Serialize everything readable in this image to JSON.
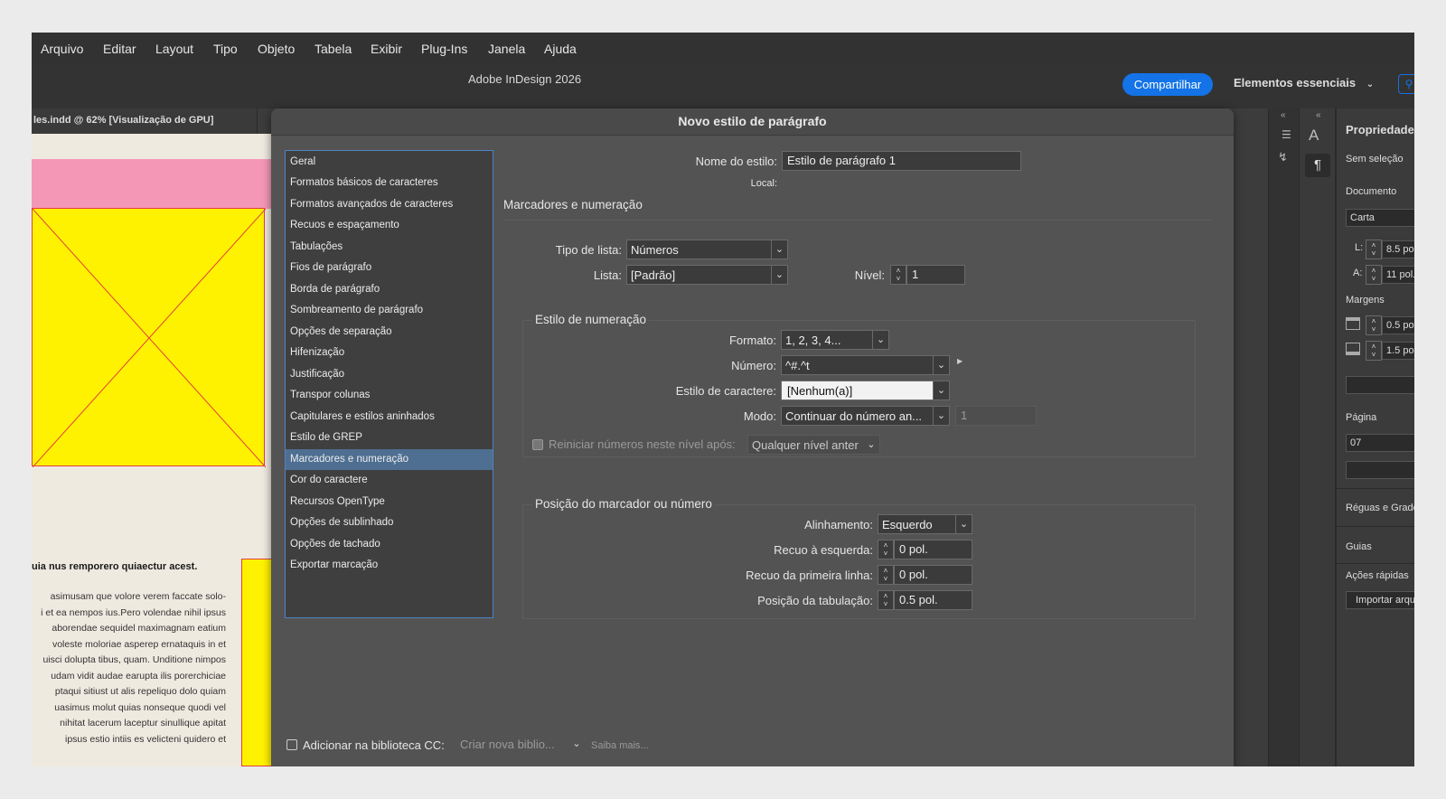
{
  "menubar": {
    "items": [
      "Arquivo",
      "Editar",
      "Layout",
      "Tipo",
      "Objeto",
      "Tabela",
      "Exibir",
      "Plug-Ins",
      "Janela",
      "Ajuda"
    ]
  },
  "titlebar": {
    "app_title": "Adobe InDesign 2026",
    "share_label": "Compartilhar",
    "workspace_label": "Elementos essenciais",
    "workspace_icon": "chevron-down-icon",
    "search_icon": "search-icon"
  },
  "document": {
    "tab_label": "les.indd @ 62% [Visualização de GPU]",
    "headline": "uia nus remporero quiaectur acest.",
    "body_lines": [
      "asimusam que volore verem faccate solo-",
      "i et ea nempos ius.Pero volendae nihil ipsus",
      "aborendae sequidel maximagnam eatium",
      "voleste moloriae asperep ernataquis in et",
      "uisci dolupta tibus, quam. Unditione nimpos",
      "udam vidit audae earupta ilis porerchiciae",
      "ptaqui sitiust ut alis repeliquo dolo quiam",
      "uasimus molut quias nonseque quodi vel",
      "nihitat lacerum laceptur sinullique apitat",
      " ipsus estio intiis es velicteni quidero et"
    ]
  },
  "properties": {
    "title": "Propriedades",
    "no_selection": "Sem seleção",
    "document_label": "Documento",
    "preset": "Carta",
    "width_label": "L:",
    "width": "8.5 pol.",
    "height_label": "A:",
    "height": "11 pol.",
    "margins_label": "Margens",
    "margin_top": "0.5 pol.",
    "margin_bottom": "1.5 pol.",
    "page_label": "Página",
    "page": "07",
    "rulers_label": "Réguas e Grades",
    "guides_label": "Guias",
    "quick_actions_label": "Ações rápidas",
    "import_label": "Importar arqu"
  },
  "dialog": {
    "title": "Novo estilo de parágrafo",
    "categories": [
      "Geral",
      "Formatos básicos de caracteres",
      "Formatos avançados de caracteres",
      "Recuos e espaçamento",
      "Tabulações",
      "Fios de parágrafo",
      "Borda de parágrafo",
      "Sombreamento de parágrafo",
      "Opções de separação",
      "Hifenização",
      "Justificação",
      "Transpor colunas",
      "Capitulares e estilos aninhados",
      "Estilo de GREP",
      "Marcadores e numeração",
      "Cor do caractere",
      "Recursos OpenType",
      "Opções de sublinhado",
      "Opções de tachado",
      "Exportar marcação"
    ],
    "selected_category": "Marcadores e numeração",
    "style_name_label": "Nome do estilo:",
    "style_name": "Estilo de parágrafo 1",
    "local_label": "Local:",
    "section_title": "Marcadores e numeração",
    "list_type_label": "Tipo de lista:",
    "list_type": "Números",
    "list_label": "Lista:",
    "list": "[Padrão]",
    "level_label": "Nível:",
    "level": "1",
    "numbering_group": "Estilo de numeração",
    "format_label": "Formato:",
    "format": "1, 2, 3, 4...",
    "number_label": "Número:",
    "number": "^#.^t",
    "char_style_label": "Estilo de caractere:",
    "char_style": "[Nenhum(a)]",
    "mode_label": "Modo:",
    "mode": "Continuar do número an...",
    "mode_start": "1",
    "restart_label": "Reiniciar números neste nível após:",
    "restart_value": "Qualquer nível anter",
    "position_group": "Posição do marcador ou número",
    "alignment_label": "Alinhamento:",
    "alignment": "Esquerdo",
    "left_indent_label": "Recuo à esquerda:",
    "left_indent": "0 pol.",
    "first_line_label": "Recuo da primeira linha:",
    "first_line": "0 pol.",
    "tab_position_label": "Posição da tabulação:",
    "tab_position": "0.5 pol.",
    "cc_library_label": "Adicionar na biblioteca CC:",
    "cc_library_value": "Criar nova biblio...",
    "learn_more": "Saiba mais..."
  },
  "colors": {
    "accent": "#1473e6",
    "selection": "#4e6e92",
    "frame_fill": "#fff200",
    "frame_stroke": "#e2403f",
    "pink_band": "#f497b6"
  }
}
